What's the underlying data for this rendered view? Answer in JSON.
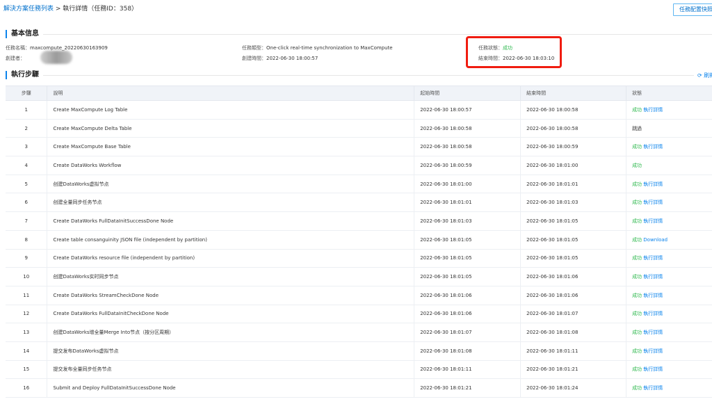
{
  "breadcrumb": {
    "parent": "解決方案任務列表",
    "separator": " > ",
    "current": "執行詳情（任務ID：358）"
  },
  "header": {
    "config_button": "任務配置快照"
  },
  "basic_info": {
    "title": "基本信息",
    "task_name_label": "任務名稱：",
    "task_name_value": "maxcompute_20220630163909",
    "creator_label": "創建者：",
    "task_type_label": "任務類型：",
    "task_type_value": "One-click real-time synchronization to MaxCompute",
    "create_time_label": "創建時間：",
    "create_time_value": "2022-06-30 18:00:57",
    "status_label": "任務狀態：",
    "status_value": "成功",
    "end_time_label": "結束時間：",
    "end_time_value": "2022-06-30 18:03:10"
  },
  "steps_section": {
    "title": "執行步驟",
    "refresh_label": "刷新"
  },
  "table": {
    "headers": {
      "step": "步驟",
      "desc": "說明",
      "start": "起始時間",
      "end": "結束時間",
      "status": "狀態"
    },
    "rows": [
      {
        "step": "1",
        "desc": "Create MaxCompute Log Table",
        "start": "2022-06-30 18:00:57",
        "end": "2022-06-30 18:00:58",
        "status": "成功",
        "action": "執行詳情"
      },
      {
        "step": "2",
        "desc": "Create MaxCompute Delta Table",
        "start": "2022-06-30 18:00:58",
        "end": "2022-06-30 18:00:58",
        "status": "跳過",
        "action": ""
      },
      {
        "step": "3",
        "desc": "Create MaxCompute Base Table",
        "start": "2022-06-30 18:00:58",
        "end": "2022-06-30 18:00:59",
        "status": "成功",
        "action": "執行詳情"
      },
      {
        "step": "4",
        "desc": "Create DataWorks Workflow",
        "start": "2022-06-30 18:00:59",
        "end": "2022-06-30 18:01:00",
        "status": "成功",
        "action": ""
      },
      {
        "step": "5",
        "desc": "创建DataWorks虚拟节点",
        "start": "2022-06-30 18:01:00",
        "end": "2022-06-30 18:01:01",
        "status": "成功",
        "action": "執行詳情"
      },
      {
        "step": "6",
        "desc": "创建全量同步任务节点",
        "start": "2022-06-30 18:01:01",
        "end": "2022-06-30 18:01:03",
        "status": "成功",
        "action": "執行詳情"
      },
      {
        "step": "7",
        "desc": "Create DataWorks FullDataInitSuccessDone Node",
        "start": "2022-06-30 18:01:03",
        "end": "2022-06-30 18:01:05",
        "status": "成功",
        "action": "執行詳情"
      },
      {
        "step": "8",
        "desc": "Create table consanguinity JSON file (independent by partition)",
        "start": "2022-06-30 18:01:05",
        "end": "2022-06-30 18:01:05",
        "status": "成功",
        "action": "Download"
      },
      {
        "step": "9",
        "desc": "Create DataWorks resource file (independent by partition)",
        "start": "2022-06-30 18:01:05",
        "end": "2022-06-30 18:01:05",
        "status": "成功",
        "action": "執行詳情"
      },
      {
        "step": "10",
        "desc": "创建DataWorks实时同步节点",
        "start": "2022-06-30 18:01:05",
        "end": "2022-06-30 18:01:06",
        "status": "成功",
        "action": "執行詳情"
      },
      {
        "step": "11",
        "desc": "Create DataWorks StreamCheckDone Node",
        "start": "2022-06-30 18:01:06",
        "end": "2022-06-30 18:01:06",
        "status": "成功",
        "action": "執行詳情"
      },
      {
        "step": "12",
        "desc": "Create DataWorks FullDataInitCheckDone Node",
        "start": "2022-06-30 18:01:06",
        "end": "2022-06-30 18:01:07",
        "status": "成功",
        "action": "執行詳情"
      },
      {
        "step": "13",
        "desc": "创建DataWorks增全量Merge Into节点（按分区周期）",
        "start": "2022-06-30 18:01:07",
        "end": "2022-06-30 18:01:08",
        "status": "成功",
        "action": "執行詳情"
      },
      {
        "step": "14",
        "desc": "提交发布DataWorks虚拟节点",
        "start": "2022-06-30 18:01:08",
        "end": "2022-06-30 18:01:11",
        "status": "成功",
        "action": "執行詳情"
      },
      {
        "step": "15",
        "desc": "提交发布全量同步任务节点",
        "start": "2022-06-30 18:01:11",
        "end": "2022-06-30 18:01:21",
        "status": "成功",
        "action": "執行詳情"
      },
      {
        "step": "16",
        "desc": "Submit and Deploy FullDataInitSuccessDone Node",
        "start": "2022-06-30 18:01:21",
        "end": "2022-06-30 18:01:24",
        "status": "成功",
        "action": "執行詳情"
      }
    ]
  },
  "colors": {
    "accent": "#0a83ec",
    "success": "#2db84d",
    "highlight": "#f01c10"
  }
}
